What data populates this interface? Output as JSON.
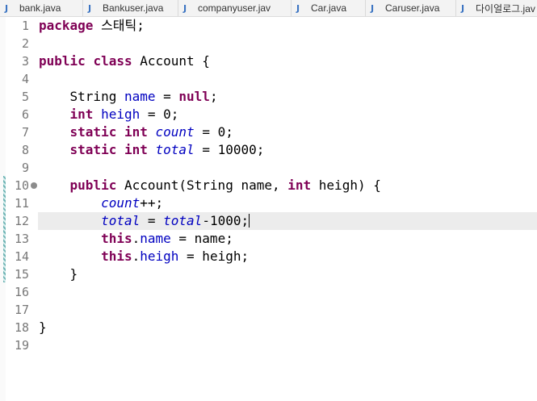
{
  "tabs": [
    {
      "icon": "java-file-icon",
      "glyph": "J",
      "label": "bank.java"
    },
    {
      "icon": "java-file-icon",
      "glyph": "J",
      "label": "Bankuser.java"
    },
    {
      "icon": "java-file-icon",
      "glyph": "J",
      "label": "companyuser.jav"
    },
    {
      "icon": "java-file-icon",
      "glyph": "J",
      "label": "Car.java"
    },
    {
      "icon": "java-file-icon",
      "glyph": "J",
      "label": "Caruser.java"
    },
    {
      "icon": "java-file-icon",
      "glyph": "J",
      "label": "다이얼로그.jav"
    }
  ],
  "editor": {
    "line_numbers": [
      "1",
      "2",
      "3",
      "4",
      "5",
      "6",
      "7",
      "8",
      "9",
      "10",
      "11",
      "12",
      "13",
      "14",
      "15",
      "16",
      "17",
      "18",
      "19"
    ],
    "current_line": "12",
    "code": {
      "l1": [
        "package",
        " 스태틱;"
      ],
      "l3": [
        "public",
        " ",
        "class",
        " Account {"
      ],
      "l5": [
        "    String ",
        "name",
        " = ",
        "null",
        ";"
      ],
      "l6": [
        "    ",
        "int",
        " ",
        "heigh",
        " = 0;"
      ],
      "l7": [
        "    ",
        "static",
        " ",
        "int",
        " ",
        "count",
        " = 0;"
      ],
      "l8": [
        "    ",
        "static",
        " ",
        "int",
        " ",
        "total",
        " = 10000;"
      ],
      "l10": [
        "    ",
        "public",
        " Account(String name, ",
        "int",
        " heigh) {"
      ],
      "l11": [
        "        ",
        "count",
        "++;"
      ],
      "l12": [
        "        ",
        "total",
        " = ",
        "total",
        "-1000;"
      ],
      "l13": [
        "        ",
        "this",
        ".",
        "name",
        " = name;"
      ],
      "l14": [
        "        ",
        "this",
        ".",
        "heigh",
        " = heigh;"
      ],
      "l15": [
        "    }"
      ],
      "l18": [
        "}"
      ]
    }
  },
  "colors": {
    "keyword": "#7f0055",
    "field": "#0000c0",
    "line_number": "#787878",
    "current_line_bg": "#ececec",
    "change_bar": "#6fb4b4"
  }
}
